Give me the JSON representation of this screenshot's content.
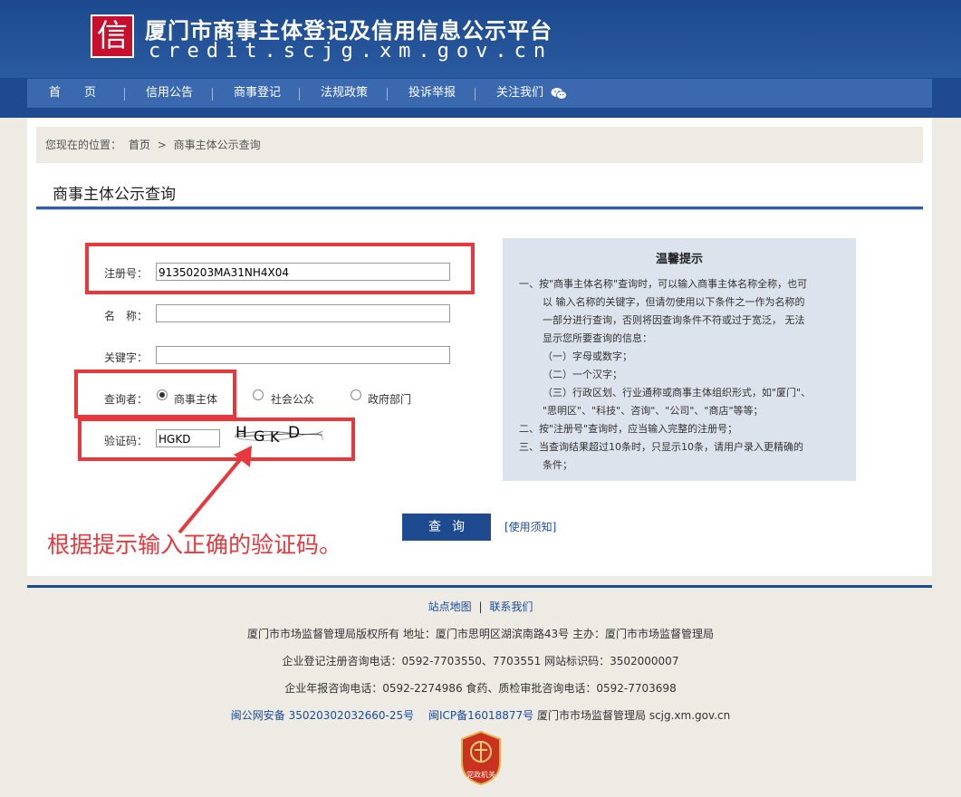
{
  "header": {
    "logo_char": "信",
    "title": "厦门市商事主体登记及信用信息公示平台",
    "url": "credit.scjg.xm.gov.cn"
  },
  "nav": {
    "items": [
      "首　　页",
      "信用公告",
      "商事登记",
      "法规政策",
      "投诉举报",
      "关注我们"
    ]
  },
  "breadcrumb": {
    "prefix": "您现在的位置：",
    "home": "首页",
    "sep": ">",
    "current": "商事主体公示查询"
  },
  "section_title": "商事主体公示查询",
  "form": {
    "reg_label": "注册号：",
    "reg_value": "91350203MA31NH4X04",
    "name_label": "名　称：",
    "name_value": "",
    "keyword_label": "关键字：",
    "keyword_value": "",
    "querier_label": "查询者：",
    "radio_options": [
      "商事主体",
      "社会公众",
      "政府部门"
    ],
    "selected_radio": "商事主体",
    "captcha_label": "验证码：",
    "captcha_value": "HGKD",
    "captcha_image_text": "HGKD",
    "query_button": "查询",
    "help_link": "[使用须知]"
  },
  "tips": {
    "title": "温馨提示",
    "lines": [
      "一、按\"商事主体名称\"查询时，可以输入商事主体名称全称，也可",
      "以 输入名称的关键字，但请勿使用以下条件之一作为名称的",
      "一部分进行查询，否则将因查询条件不符或过于宽泛， 无法",
      "显示您所要查询的信息：",
      "（一）字母或数字；",
      "（二）一个汉字；",
      "（三）行政区划、行业通称或商事主体组织形式，如\"厦门\"、",
      "\"思明区\"、\"科技\"、咨询\"、\"公司\"、\"商店\"等等；",
      "二、按\"注册号\"查询时，应当输入完整的注册号；",
      "三、当查询结果超过10条时，只显示10条，请用户录入更精确的",
      "条件；"
    ]
  },
  "annotation": "根据提示输入正确的验证码。",
  "footer": {
    "links": [
      "站点地图",
      "|",
      "联系我们"
    ],
    "line1": "厦门市市场监督管理局版权所有 地址：厦门市思明区湖滨南路43号 主办：厦门市市场监督管理局",
    "line2": "企业登记注册咨询电话：0592-7703550、7703551 网站标识码：3502000007",
    "line3": "企业年报咨询电话：0592-2274986 食药、质检审批咨询电话：0592-7703698",
    "beian_police": "闽公网安备 35020302032660-25号",
    "beian_icp": "闽ICP备16018877号",
    "beian_tail": "厦门市市场监督管理局 scjg.xm.gov.cn",
    "badge_text": "党政机关"
  },
  "colors": {
    "header_blue": "#1e4b8f",
    "nav_blue": "#3a69b0",
    "annotation_red": "#e8383d",
    "tips_bg": "#dde3ec"
  }
}
